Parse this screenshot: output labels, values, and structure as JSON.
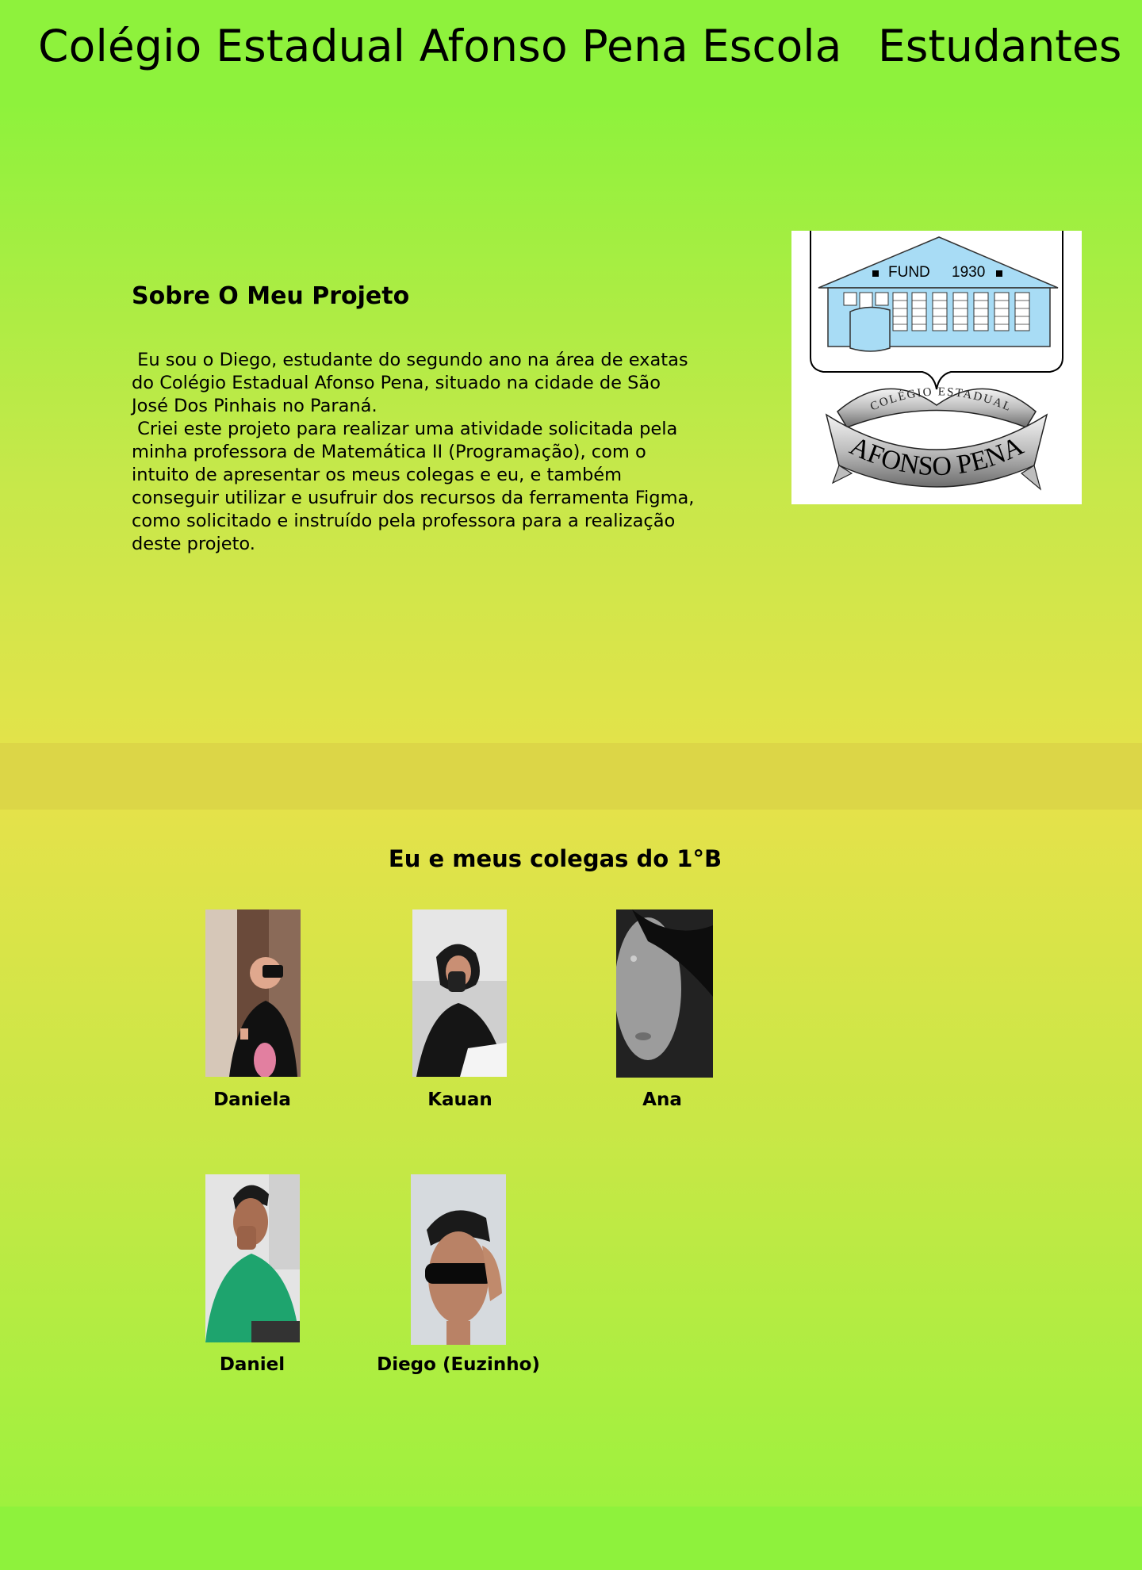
{
  "header": {
    "site_title": "Colégio Estadual Afonso Pena",
    "nav": [
      "Escola",
      "Estudantes"
    ]
  },
  "about": {
    "heading": "Sobre O Meu Projeto",
    "paragraphs": [
      " Eu sou o Diego, estudante do segundo ano na área de exatas do Colégio Estadual Afonso Pena, situado na cidade de São José Dos Pinhais no Paraná.",
      " Criei este projeto para realizar uma atividade solicitada pela minha professora de Matemática II (Programação), com o intuito de apresentar os meus colegas e eu, e também conseguir utilizar e usufruir dos recursos da ferramenta Figma, como solicitado e instruído pela professora para a realização deste projeto."
    ]
  },
  "logo": {
    "fund_label": "FUND",
    "year": "1930",
    "ribbon_top": "COLÉGIO ESTADUAL",
    "ribbon_main": "AFONSO PENA"
  },
  "classmates": {
    "heading": "Eu e meus colegas do 1°B",
    "people": [
      {
        "name": "Daniela"
      },
      {
        "name": "Kauan"
      },
      {
        "name": "Ana"
      },
      {
        "name": "Daniel"
      },
      {
        "name": "Diego (Euzinho)"
      }
    ]
  }
}
